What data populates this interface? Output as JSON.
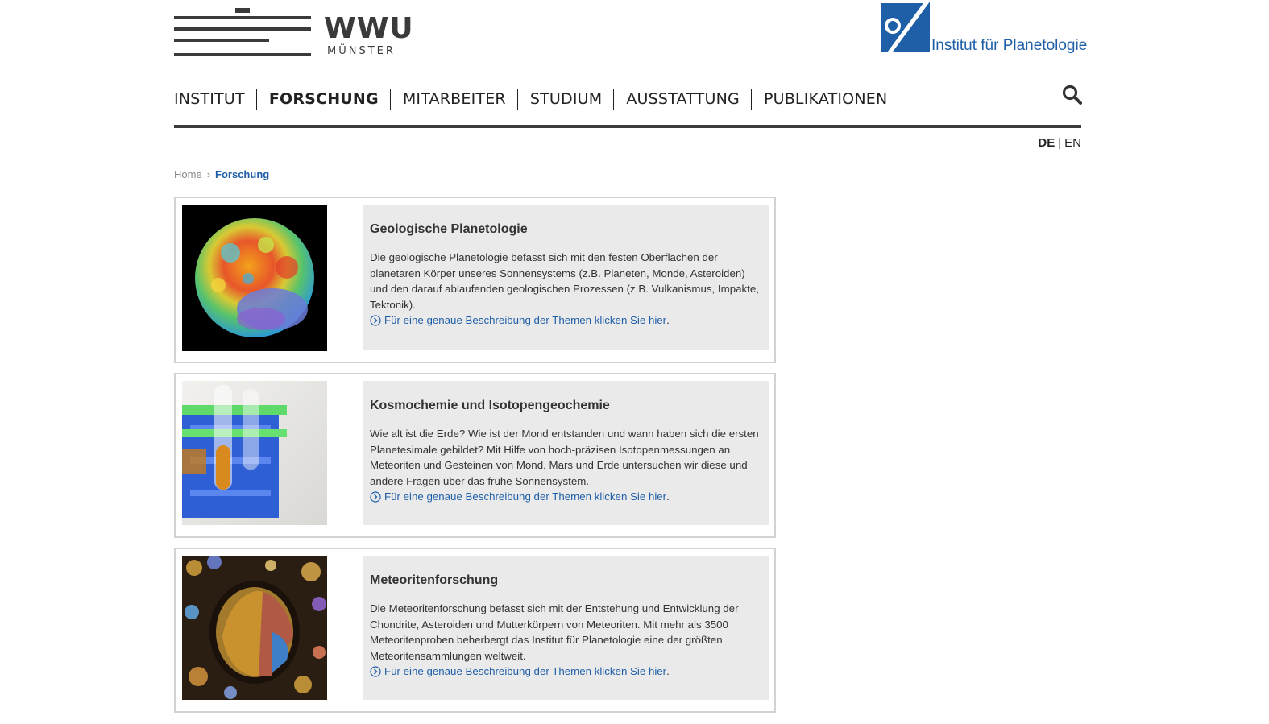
{
  "header": {
    "wwu_logo_text": "WWU",
    "wwu_logo_sub": "MÜNSTER",
    "institute_name": "Institut für Planetologie",
    "brand_color": "#1f5fa8"
  },
  "nav": {
    "items": [
      {
        "label": "INSTITUT",
        "active": false
      },
      {
        "label": "FORSCHUNG",
        "active": true
      },
      {
        "label": "MITARBEITER",
        "active": false
      },
      {
        "label": "STUDIUM",
        "active": false
      },
      {
        "label": "AUSSTATTUNG",
        "active": false
      },
      {
        "label": "PUBLIKATIONEN",
        "active": false
      }
    ],
    "search_icon": "search-icon"
  },
  "lang": {
    "de": "DE",
    "sep": "|",
    "en": "EN"
  },
  "breadcrumb": {
    "home": "Home",
    "separator": "›",
    "current": "Forschung"
  },
  "cards": [
    {
      "title": "Geologische Planetologie",
      "text": "Die geologische Planetologie befasst sich mit den festen Oberflächen der planetaren Körper unseres Sonnensystems (z.B. Planeten, Monde, Asteroiden) und den darauf ablaufenden geologischen Prozessen (z.B. Vulkanismus, Impakte, Tektonik).",
      "link": "Für eine genaue Beschreibung der Themen klicken Sie hier",
      "link_end": ".",
      "image": "moon-topography-image"
    },
    {
      "title": "Kosmochemie und Isotopengeochemie",
      "text": "Wie alt ist die Erde? Wie ist der Mond entstanden und wann haben sich die ersten Planetesimale gebildet? Mit Hilfe von hoch-präzisen Isotopenmessungen an Meteoriten und Gesteinen von Mond, Mars und Erde untersuchen wir diese und andere Fragen über das frühe Sonnensystem.",
      "link": "Für eine genaue Beschreibung der Themen klicken Sie hier",
      "link_end": ".",
      "image": "test-tube-rack-image"
    },
    {
      "title": "Meteoritenforschung",
      "text": "Die Meteoritenforschung befasst sich mit der Entstehung und Entwicklung der Chondrite, Asteroiden und Mutterkörpern von Meteoriten. Mit mehr als 3500 Meteoritenproben beherbergt das Institut für Planetologie eine der größten Meteoritensammlungen weltweit.",
      "link": "Für eine genaue Beschreibung der Themen klicken Sie hier",
      "link_end": ".",
      "image": "chondrule-thin-section-image"
    }
  ]
}
